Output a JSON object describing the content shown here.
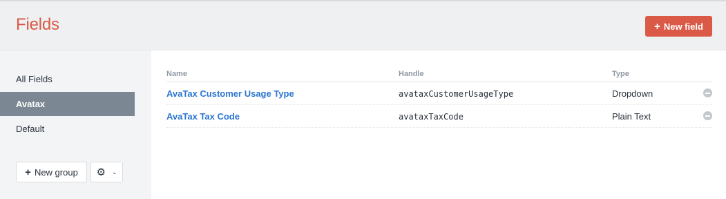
{
  "header": {
    "title": "Fields",
    "new_field_label": "New field"
  },
  "sidebar": {
    "items": [
      {
        "label": "All Fields"
      },
      {
        "label": "Avatax"
      },
      {
        "label": "Default"
      }
    ],
    "selected": "Avatax",
    "new_group_label": "New group"
  },
  "table": {
    "columns": [
      "Name",
      "Handle",
      "Type"
    ],
    "rows": [
      {
        "name": "AvaTax Customer Usage Type",
        "handle": "avataxCustomerUsageType",
        "type": "Dropdown"
      },
      {
        "name": "AvaTax Tax Code",
        "handle": "avataxTaxCode",
        "type": "Plain Text"
      }
    ]
  },
  "colors": {
    "accent": "#da5a47",
    "link": "#2c76d1",
    "selected_bg": "#7b8793"
  },
  "icons": [
    "plus-icon",
    "gear-icon",
    "chevron-down-icon",
    "delete-icon"
  ]
}
